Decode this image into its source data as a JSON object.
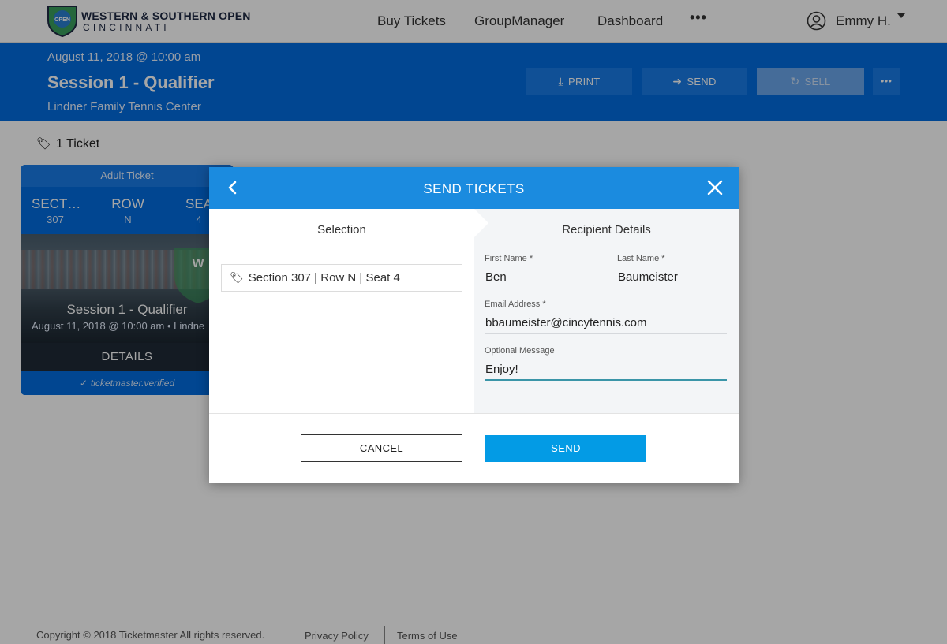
{
  "brand": {
    "line1": "WESTERN & SOUTHERN OPEN",
    "line2": "CINCINNATI",
    "seal_text": "OPEN"
  },
  "nav": {
    "links": [
      "Buy Tickets",
      "GroupManager",
      "Dashboard"
    ],
    "more": "•••",
    "user_name": "Emmy H."
  },
  "event": {
    "date": "August 11, 2018 @ 10:00 am",
    "title": "Session 1 - Qualifier",
    "venue": "Lindner Family Tennis Center",
    "actions": {
      "print": "PRINT",
      "send": "SEND",
      "sell": "SELL",
      "more": "•••"
    }
  },
  "tickets": {
    "count_label": "1 Ticket"
  },
  "card": {
    "type": "Adult Ticket",
    "section_label": "SECT…",
    "section_value": "307",
    "row_label": "ROW",
    "row_value": "N",
    "seat_label": "SEA",
    "seat_value": "4",
    "session": "Session 1 - Qualifier",
    "when": "August 11, 2018 @ 10:00 am • Lindne",
    "details": "DETAILS",
    "verified": "ticketmaster.verified",
    "seal_text": "W"
  },
  "modal": {
    "title": "SEND TICKETS",
    "selection_heading": "Selection",
    "recipient_heading": "Recipient Details",
    "selection_item": "Section 307 | Row N | Seat 4",
    "first_name_label": "First Name *",
    "first_name_value": "Ben",
    "last_name_label": "Last Name *",
    "last_name_value": "Baumeister",
    "email_label": "Email Address *",
    "email_value": "bbaumeister@cincytennis.com",
    "message_label": "Optional Message",
    "message_value": "Enjoy!",
    "cancel": "CANCEL",
    "send": "SEND"
  },
  "footer": {
    "copyright": "Copyright © 2018 Ticketmaster All rights reserved.",
    "privacy": "Privacy Policy",
    "terms": "Terms of Use"
  },
  "colors": {
    "header_blue": "#026cdf",
    "modal_header": "#1b8bdf",
    "send_button": "#039be5",
    "active_underline": "#3a95a8"
  }
}
